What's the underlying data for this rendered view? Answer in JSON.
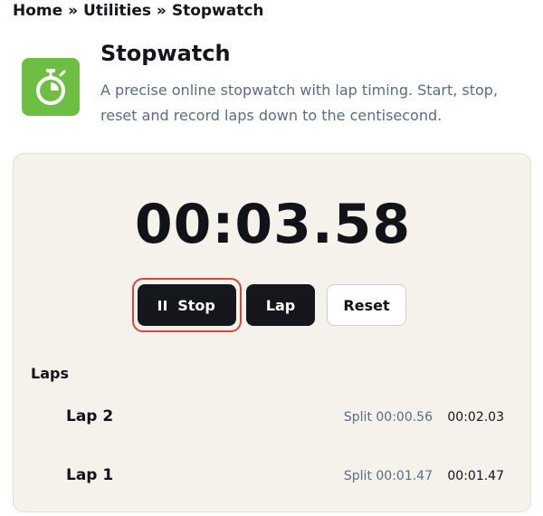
{
  "breadcrumb": {
    "items": [
      "Home",
      "Utilities",
      "Stopwatch"
    ],
    "separator": "»"
  },
  "header": {
    "icon": "stopwatch-icon",
    "icon_color": "#6fbe44",
    "title": "Stopwatch",
    "description": "A precise online stopwatch with lap timing. Start, stop, reset and record laps down to the centisecond."
  },
  "stopwatch": {
    "display": "00:03.58",
    "buttons": {
      "stop_label": "Stop",
      "stop_icon": "pause-icon",
      "lap_label": "Lap",
      "reset_label": "Reset"
    },
    "focus_ring_color": "#d9443d"
  },
  "laps": {
    "heading": "Laps",
    "items": [
      {
        "name": "Lap 2",
        "split": "Split 00:00.56",
        "total": "00:02.03"
      },
      {
        "name": "Lap 1",
        "split": "Split 00:01.47",
        "total": "00:01.47"
      }
    ]
  }
}
